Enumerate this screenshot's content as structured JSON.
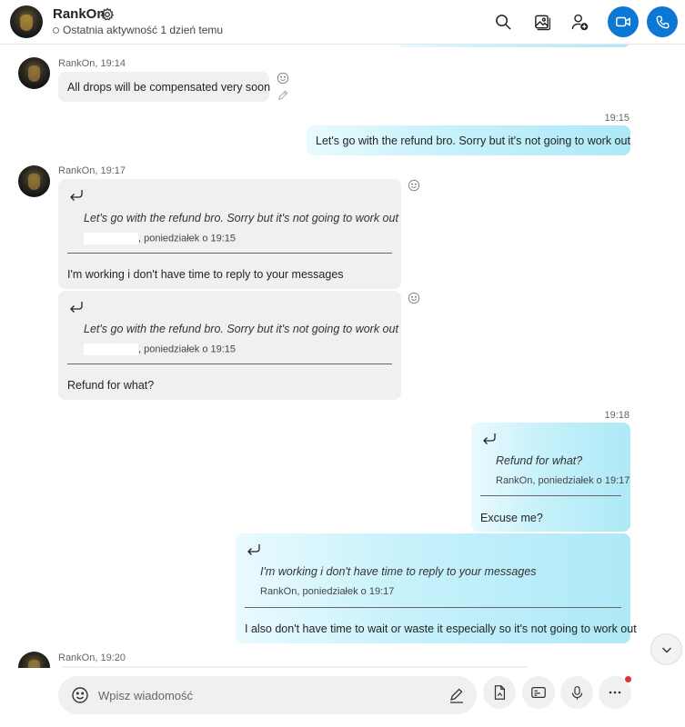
{
  "header": {
    "contact_name": "RankOn",
    "status": "Ostatnia aktywność 1 dzień temu"
  },
  "messages": {
    "m1": {
      "meta": "RankOn, 19:14",
      "text": "All drops will be compensated very soon"
    },
    "m2": {
      "time": "19:15",
      "text": "Let's go with the refund bro. Sorry but it's not going to work out"
    },
    "m3": {
      "meta": "RankOn, 19:17",
      "quote_text": "Let's go with the refund bro. Sorry but it's not going to work out",
      "quote_meta": ", poniedziałek o 19:15",
      "text": "I'm working i don't have time to reply to your messages"
    },
    "m4": {
      "quote_text": "Let's go with the refund bro. Sorry but it's not going to work out",
      "quote_meta": ", poniedziałek o 19:15",
      "text": "Refund for what?"
    },
    "m5": {
      "time": "19:18",
      "quote_text": "Refund for what?",
      "quote_meta": "RankOn, poniedziałek o 19:17",
      "text": "Excuse me?"
    },
    "m6": {
      "quote_text": "I'm working i don't have time to reply to your messages",
      "quote_meta": "RankOn, poniedziałek o 19:17",
      "text": "I also don't have time to wait or waste it especially so it's not going to work out"
    },
    "m7": {
      "meta": "RankOn, 19:20"
    }
  },
  "composer": {
    "placeholder": "Wpisz wiadomość"
  },
  "icons": [
    "gear-icon",
    "search-icon",
    "gallery-icon",
    "add-person-icon",
    "video-call-icon",
    "audio-call-icon",
    "reply-arrow-icon",
    "smiley-icon",
    "edit-pencil-icon",
    "chevron-down-icon",
    "format-pen-icon",
    "file-icon",
    "contact-card-icon",
    "microphone-icon",
    "more-icon"
  ],
  "colors": {
    "accent": "#0a78d4",
    "outgoing_bubble": "#c6f1fb",
    "incoming_bubble": "#f0f0f0",
    "notification_dot": "#e03131"
  }
}
